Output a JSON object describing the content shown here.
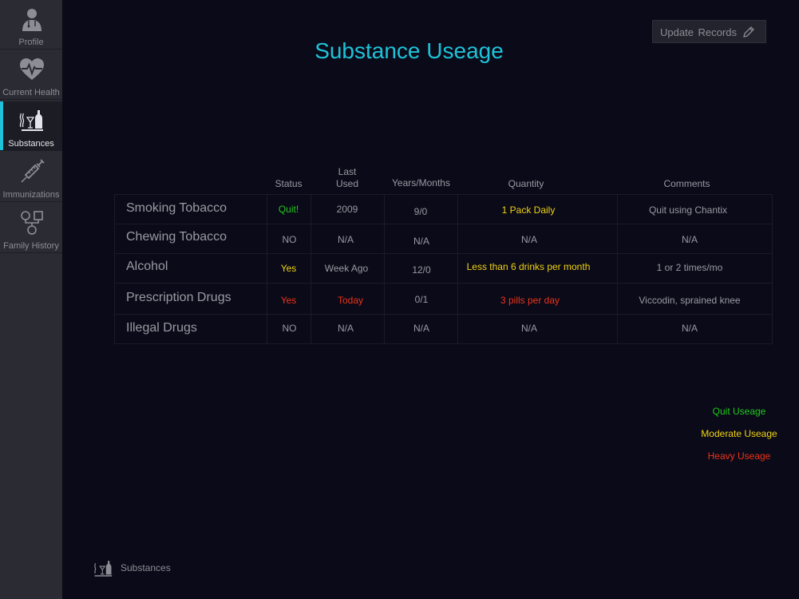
{
  "sidebar": {
    "items": [
      {
        "label": "Profile",
        "icon": "profile-icon",
        "active": false
      },
      {
        "label": "Current Health",
        "icon": "heart-pulse-icon",
        "active": false
      },
      {
        "label": "Substances",
        "icon": "substances-icon",
        "active": true
      },
      {
        "label": "Immunizations",
        "icon": "syringe-icon",
        "active": false
      },
      {
        "label": "Family History",
        "icon": "family-tree-icon",
        "active": false
      }
    ]
  },
  "header": {
    "title": "Substance Useage",
    "update_button": {
      "label": "Update Records",
      "icon": "pencil-icon"
    }
  },
  "table": {
    "columns": [
      "Status",
      "Last Used",
      "Years/Months",
      "Quantity",
      "Comments"
    ],
    "rows": [
      {
        "substance": "Smoking Tobacco",
        "status": "Quit!",
        "last_used": "2009",
        "years_months": "9/0",
        "quantity": "1 Pack Daily",
        "comments": "Quit using Chantix"
      },
      {
        "substance": "Chewing Tobacco",
        "status": "NO",
        "last_used": "N/A",
        "years_months": "N/A",
        "quantity": "N/A",
        "comments": "N/A"
      },
      {
        "substance": "Alcohol",
        "status": "Yes",
        "last_used": "Week Ago",
        "years_months": "12/0",
        "quantity": "Less than 6 drinks per month",
        "comments": "1 or 2 times/mo"
      },
      {
        "substance": "Prescription Drugs",
        "status": "Yes",
        "last_used": "Today",
        "years_months": "0/1",
        "quantity": "3 pills per day",
        "comments": "Viccodin, sprained knee"
      },
      {
        "substance": "Illegal Drugs",
        "status": "NO",
        "last_used": "N/A",
        "years_months": "N/A",
        "quantity": "N/A",
        "comments": "N/A"
      }
    ]
  },
  "legend": {
    "items": [
      {
        "label": "Quit Useage",
        "color": "#22c71d"
      },
      {
        "label": "Moderate Useage",
        "color": "#f1d312"
      },
      {
        "label": "Heavy Useage",
        "color": "#ee3418"
      }
    ]
  },
  "footer": {
    "label": "Substances",
    "icon": "substances-icon"
  },
  "colors": {
    "accent": "#1ec3d8",
    "background": "#0a0a19",
    "sidebar": "#2b2b34"
  }
}
